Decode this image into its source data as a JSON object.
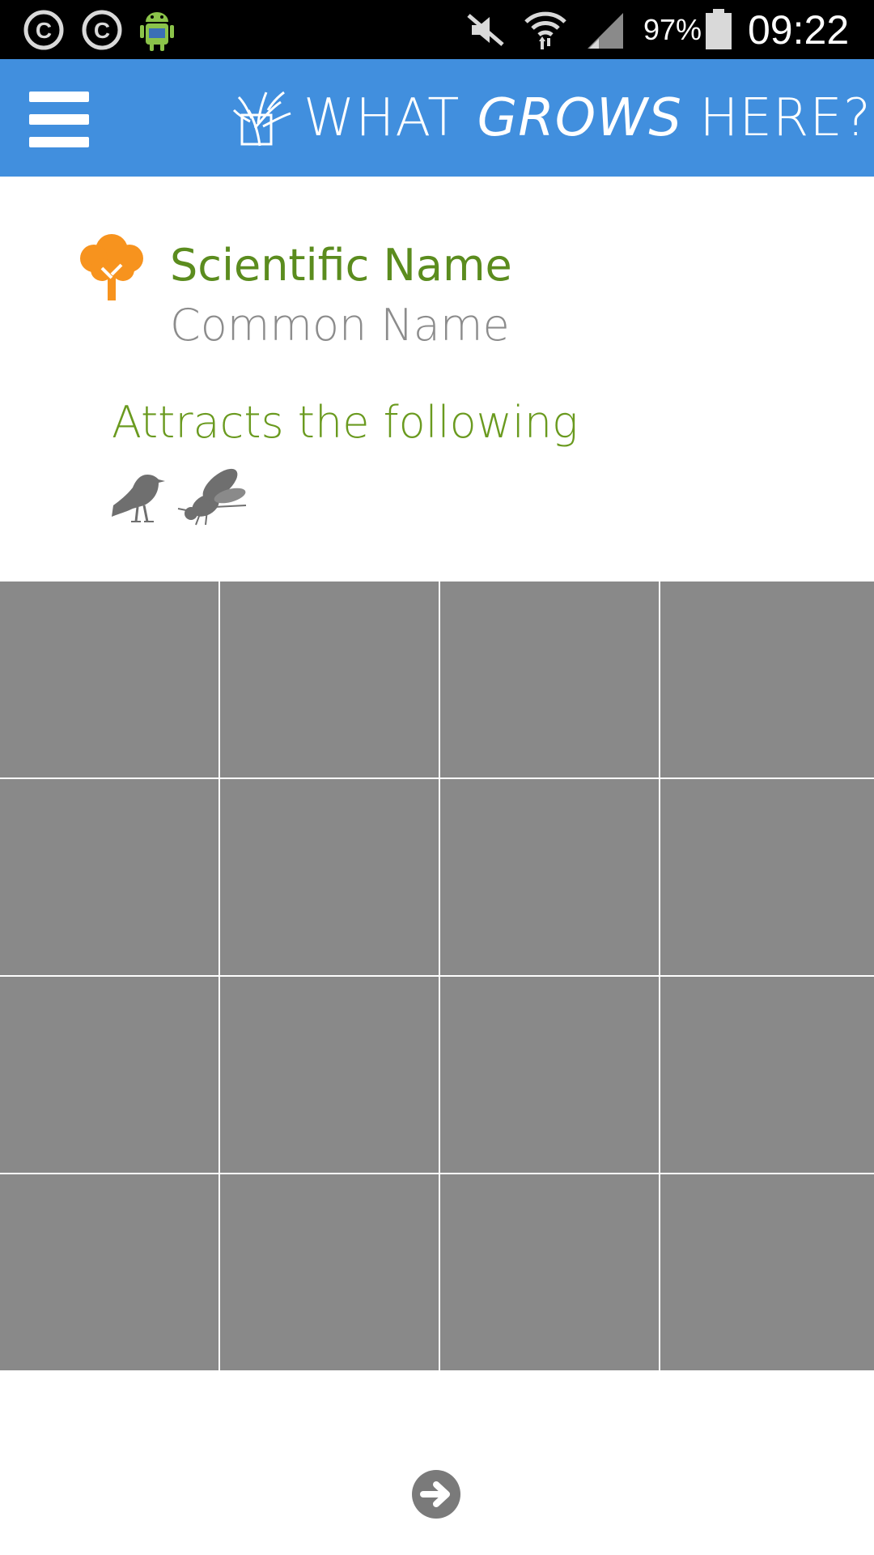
{
  "status_bar": {
    "battery_text": "97%",
    "time": "09:22",
    "icons": [
      "copyright-icon",
      "copyright-icon",
      "android-debug-icon",
      "mute-icon",
      "wifi-icon",
      "signal-icon",
      "battery-icon"
    ]
  },
  "app_bar": {
    "menu_icon": "hamburger-icon",
    "logo_icon": "plant-logo-icon",
    "title_part1": "WHAT ",
    "title_part2": "GROWS",
    "title_part3": " HERE?",
    "colors": {
      "background": "#418fde",
      "text": "#ffffff"
    }
  },
  "plant": {
    "icon": "tree-icon",
    "scientific_name": "Scientific Name",
    "common_name": "Common Name",
    "colors": {
      "icon": "#f7931e",
      "scientific_name": "#5b8c1e",
      "common_name": "#8c8c8c"
    }
  },
  "attracts": {
    "label": "Attracts the following",
    "items": [
      {
        "icon": "bird-icon"
      },
      {
        "icon": "bee-icon"
      }
    ]
  },
  "image_grid": {
    "rows": 4,
    "columns": 4,
    "cell_color": "#898989"
  },
  "navigation": {
    "next_icon": "arrow-right-circle-icon"
  }
}
